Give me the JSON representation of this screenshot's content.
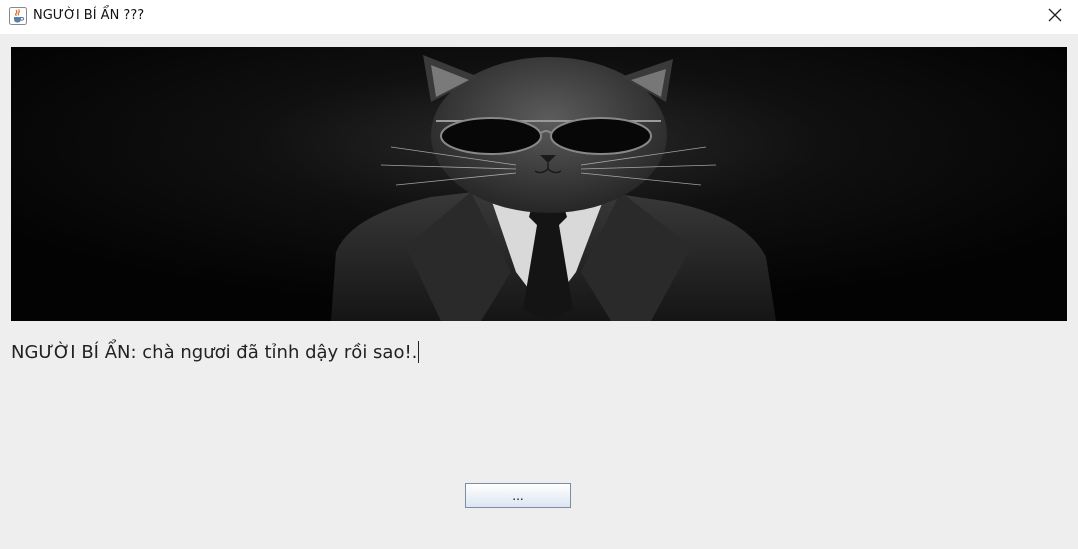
{
  "window": {
    "title": "NGƯỜI BÍ ẨN ???",
    "app_icon": "java-cup-icon",
    "close_icon": "close-icon"
  },
  "banner": {
    "image_subject": "cat-in-suit-with-sunglasses"
  },
  "dialogue": {
    "text": "NGƯỜI BÍ ẨN: chà ngươi đã tỉnh dậy rồi sao!."
  },
  "buttons": {
    "continue_label": "..."
  },
  "colors": {
    "window_bg": "#eeeeee",
    "titlebar_bg": "#ffffff",
    "banner_bg": "#050505",
    "button_border": "#7a8fa6"
  }
}
